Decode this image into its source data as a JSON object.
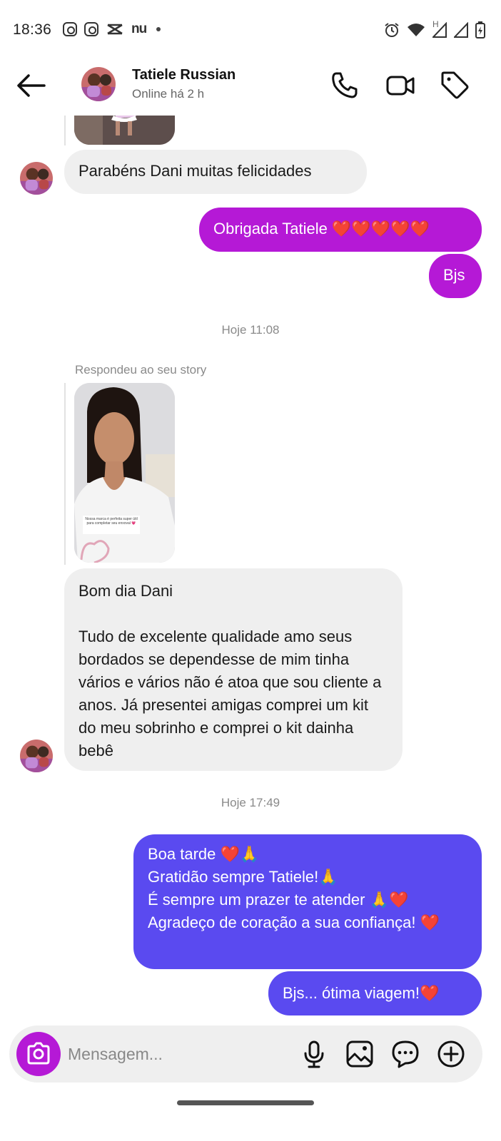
{
  "status_bar": {
    "time": "18:36",
    "left_icons": [
      "instagram-icon",
      "instagram-icon",
      "capcut-icon",
      "nubank-icon",
      "dot-icon"
    ],
    "nu_text": "nu",
    "right_icons": [
      "alarm-icon",
      "wifi-icon",
      "signal-h-icon",
      "signal-icon",
      "battery-icon"
    ],
    "network_label": "H"
  },
  "header": {
    "contact_name": "Tatiele Russian",
    "contact_status": "Online há 2 h",
    "icons": [
      "back-arrow-icon",
      "phone-icon",
      "video-icon",
      "tag-icon"
    ]
  },
  "messages": {
    "m1_in": "Parabéns Dani muitas felicidades",
    "m2_out": "Obrigada Tatiele ❤️❤️❤️❤️❤️",
    "m3_out": "Bjs",
    "ts1": "Hoje 11:08",
    "reply_label": "Respondeu ao seu story",
    "story_caption": "Nossa marca é perfeita super útil para completar seu enxoval 💗",
    "m4_in": "Bom dia Dani\n\nTudo de excelente qualidade amo seus bordados se dependesse de mim tinha vários e vários não é atoa que sou cliente a anos. Já presentei amigas comprei um kit do meu sobrinho e comprei o kit dainha bebê",
    "ts2": "Hoje 17:49",
    "m5_out": "Boa tarde ❤️🙏\nGratidão sempre Tatiele!🙏\nÉ sempre um prazer te atender 🙏❤️\nAgradeço de coração a sua confiança! ❤️",
    "m6_out": "Bjs... ótima viagem!❤️"
  },
  "composer": {
    "placeholder": "Mensagem...",
    "icons": [
      "camera-icon",
      "microphone-icon",
      "gallery-icon",
      "sticker-icon",
      "add-icon"
    ]
  },
  "colors": {
    "outgoing_purple": "#b519d6",
    "outgoing_blue": "#5a4af0",
    "incoming_gray": "#efefef"
  }
}
